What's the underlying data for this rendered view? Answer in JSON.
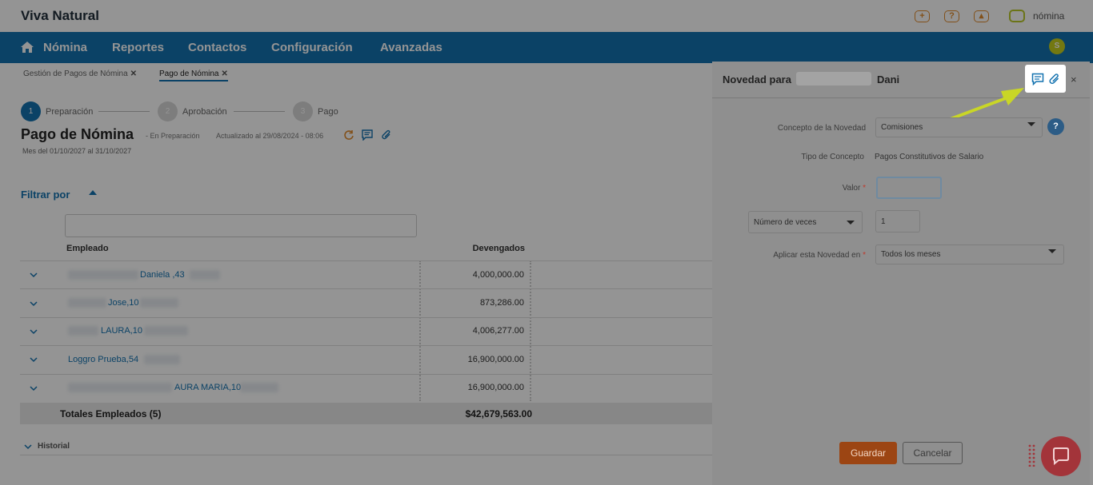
{
  "app": {
    "title": "Viva Natural",
    "logo_text": "nómina",
    "user_badge": "S"
  },
  "topbar_icons": [
    "plus-icon",
    "help-icon",
    "user-icon"
  ],
  "nav": {
    "items": [
      "Nómina",
      "Reportes",
      "Contactos",
      "Configuración",
      "Avanzadas"
    ]
  },
  "breadcrumbs": [
    {
      "label": "Gestión de Pagos de Nómina"
    },
    {
      "label": "Pago de Nómina"
    }
  ],
  "steps": [
    {
      "num": "1",
      "label": "Preparación",
      "active": true
    },
    {
      "num": "2",
      "label": "Aprobación",
      "active": false
    },
    {
      "num": "3",
      "label": "Pago",
      "active": false
    }
  ],
  "page": {
    "title": "Pago de Nómina",
    "status": "- En Preparación",
    "updated": "Actualizado al 29/08/2024 - 08:06",
    "period": "Mes del 01/10/2027 al 31/10/2027"
  },
  "filter": {
    "label": "Filtrar por"
  },
  "table": {
    "headers": {
      "employee": "Empleado",
      "earned": "Devengados"
    },
    "rows": [
      {
        "name": "Daniela ,43",
        "value": "4,000,000.00"
      },
      {
        "name": "Jose,10",
        "value": "873,286.00"
      },
      {
        "name": "LAURA,10",
        "value": "4,006,277.00"
      },
      {
        "name": "Loggro Prueba,54",
        "value": "16,900,000.00"
      },
      {
        "name": "AURA MARIA,10",
        "value": "16,900,000.00"
      }
    ],
    "totals_label": "Totales Empleados (5)",
    "totals_value": "$42,679,563.00"
  },
  "historial": {
    "label": "Historial"
  },
  "panel": {
    "title_prefix": "Novedad para",
    "title_name": "Dani",
    "close": "×",
    "fields": {
      "concepto_label": "Concepto de la Novedad",
      "concepto_value": "Comisiones",
      "tipo_label": "Tipo de Concepto",
      "tipo_value": "Pagos Constitutivos de Salario",
      "valor_label": "Valor",
      "valor_value": "",
      "veces_select": "Número de veces",
      "veces_value": "1",
      "aplicar_label": "Aplicar esta Novedad en",
      "aplicar_value": "Todos los meses"
    },
    "help": "?",
    "save_label": "Guardar",
    "cancel_label": "Cancelar"
  },
  "colors": {
    "nav_bg": "#1372b0",
    "accent_lime": "#c7cf1e",
    "save_btn": "#d1611f",
    "chat_bubble": "#e0474f",
    "arrow": "#d5e62b"
  }
}
